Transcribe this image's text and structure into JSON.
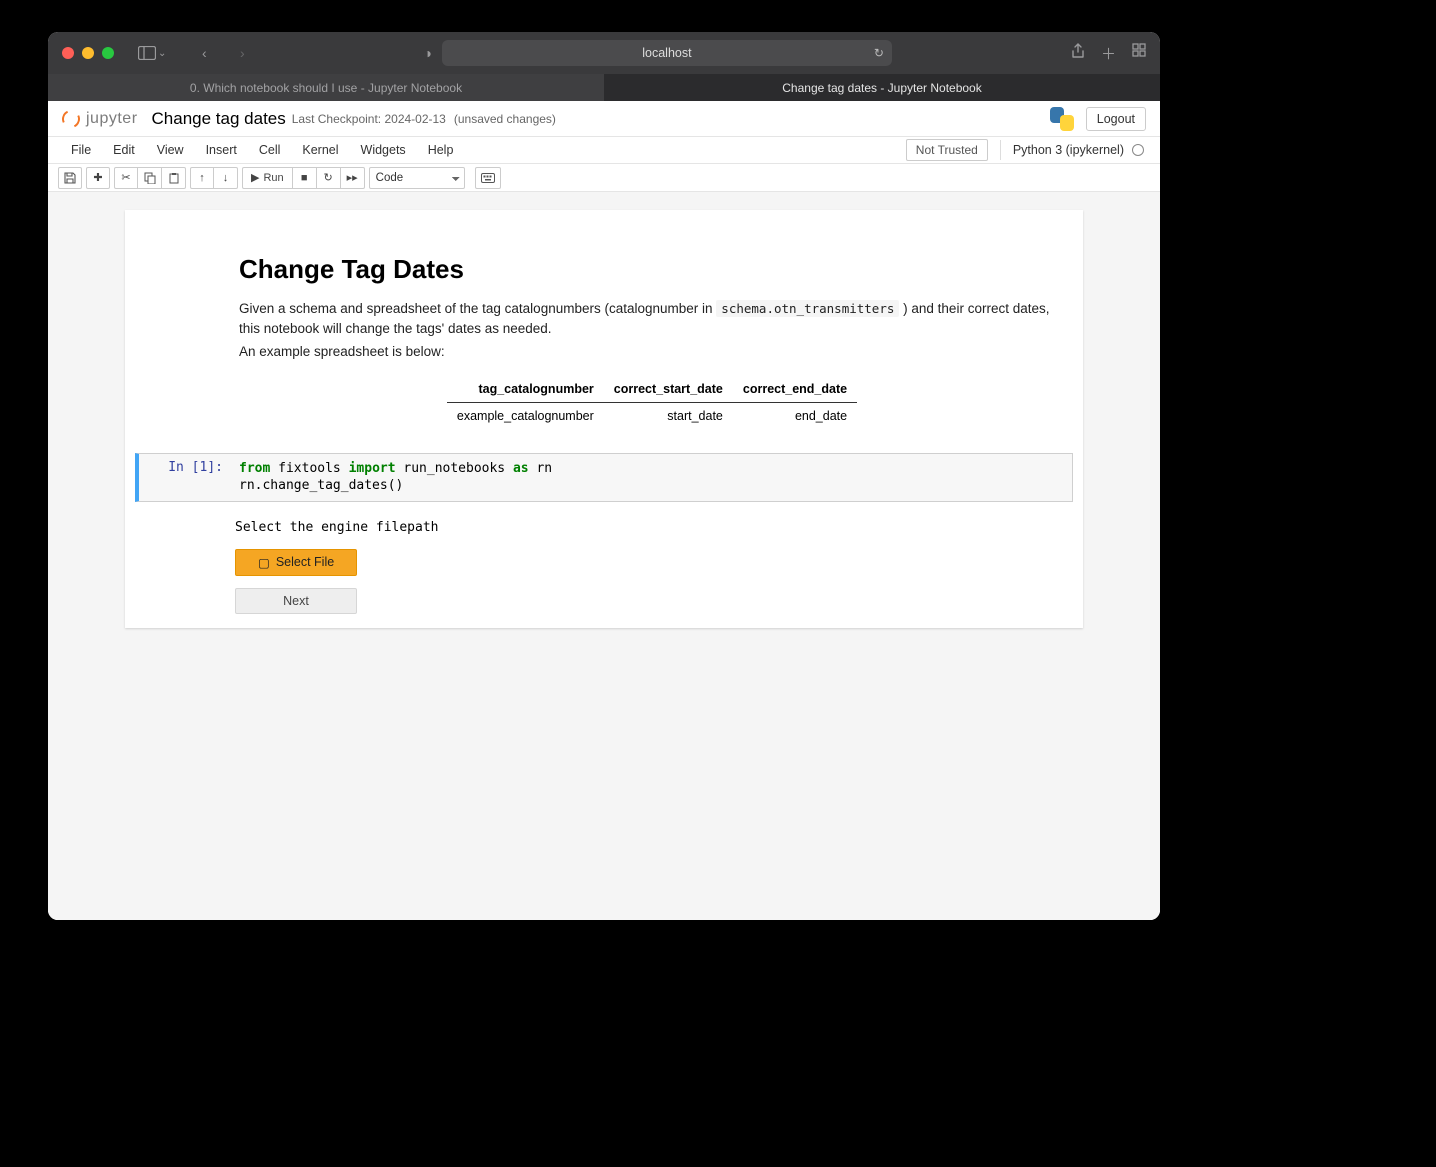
{
  "browser": {
    "address": "localhost",
    "tabs": [
      {
        "title": "0. Which notebook should I use - Jupyter Notebook",
        "active": false
      },
      {
        "title": "Change tag dates - Jupyter Notebook",
        "active": true
      }
    ]
  },
  "header": {
    "logo_text": "jupyter",
    "notebook_name": "Change tag dates",
    "checkpoint": "Last Checkpoint: 2024-02-13",
    "unsaved": "(unsaved changes)",
    "logout_label": "Logout"
  },
  "menu": {
    "items": [
      "File",
      "Edit",
      "View",
      "Insert",
      "Cell",
      "Kernel",
      "Widgets",
      "Help"
    ],
    "trust": "Not Trusted",
    "kernel": "Python 3 (ipykernel)"
  },
  "toolbar": {
    "run_label": "Run",
    "cell_type": "Code"
  },
  "markdown": {
    "title": "Change Tag Dates",
    "p1a": "Given a schema and spreadsheet of the tag catalognumbers (catalognumber in ",
    "p1code": "schema.otn_transmitters",
    "p1b": ") and their correct dates, this notebook will change the tags' dates as needed.",
    "p2": "An example spreadsheet is below:",
    "table": {
      "headers": [
        "tag_catalognumber",
        "correct_start_date",
        "correct_end_date"
      ],
      "row": [
        "example_catalognumber",
        "start_date",
        "end_date"
      ]
    }
  },
  "code_cell": {
    "prompt": "In [1]:",
    "tokens": {
      "from": "from",
      "module": "fixtools",
      "import": "import",
      "name": "run_notebooks",
      "as": "as",
      "alias": "rn",
      "line2": "rn.change_tag_dates()"
    }
  },
  "output": {
    "prompt_text": "Select the engine filepath",
    "select_file_label": "Select File",
    "next_label": "Next"
  }
}
